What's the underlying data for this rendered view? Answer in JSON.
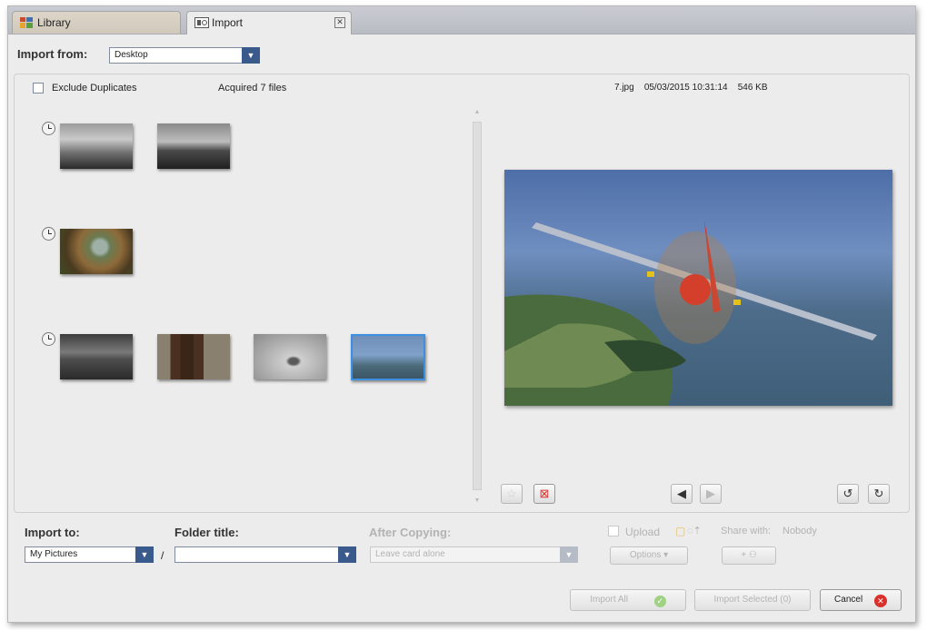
{
  "tabs": [
    {
      "label": "Library",
      "icon": "library-icon"
    },
    {
      "label": "Import",
      "icon": "import-camera-icon"
    }
  ],
  "import_from": {
    "label": "Import from:",
    "value": "Desktop"
  },
  "options": {
    "exclude_duplicates_label": "Exclude Duplicates",
    "acquired_text": "Acquired 7 files"
  },
  "file_info": {
    "name": "7.jpg",
    "date": "05/03/2015 10:31:14",
    "size": "546 KB"
  },
  "bottom": {
    "import_to_label": "Import to:",
    "import_to_value": "My Pictures",
    "separator": "/",
    "folder_title_label": "Folder title:",
    "folder_title_value": "",
    "after_copying_label": "After Copying:",
    "after_copying_value": "Leave card alone",
    "upload_label": "Upload",
    "share_with_label": "Share with:",
    "share_with_value": "Nobody",
    "options_label": "Options"
  },
  "actions": {
    "import_all": "Import All",
    "import_selected": "Import Selected (0)",
    "cancel": "Cancel"
  },
  "colors": {
    "accent": "#3a5a8c",
    "cancel_red": "#d9302c",
    "confirm_green": "#6cbf45",
    "selection": "#3d8fe0"
  }
}
